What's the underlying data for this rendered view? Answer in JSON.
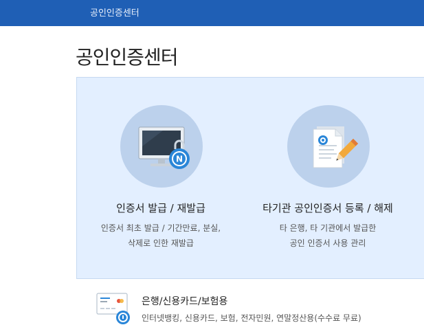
{
  "header": {
    "title": "공인인증센터"
  },
  "page": {
    "title": "공인인증센터"
  },
  "cards": [
    {
      "title": "인증서 발급 / 재발급",
      "desc_line1": "인증서 최초 발급 / 기간만료, 분실,",
      "desc_line2": "삭제로 인한 재발급",
      "icon": "monitor-lock-icon"
    },
    {
      "title": "타기관 공인인증서 등록 / 해제",
      "desc_line1": "타 은행, 타 기관에서 발급한",
      "desc_line2": "공인 인증서 사용 관리",
      "icon": "document-pen-icon"
    }
  ],
  "bank": {
    "title": "은행/신용카드/보험용",
    "desc": "인터넷뱅킹, 신용카드, 보험, 전자민원, 연말정산용(수수료 무료)",
    "icon": "card-lock-icon"
  },
  "colors": {
    "header_bg": "#1f5fb5",
    "panel_bg": "#e3efff",
    "circle_bg": "#bcd1ec",
    "accent": "#2a86d8"
  }
}
